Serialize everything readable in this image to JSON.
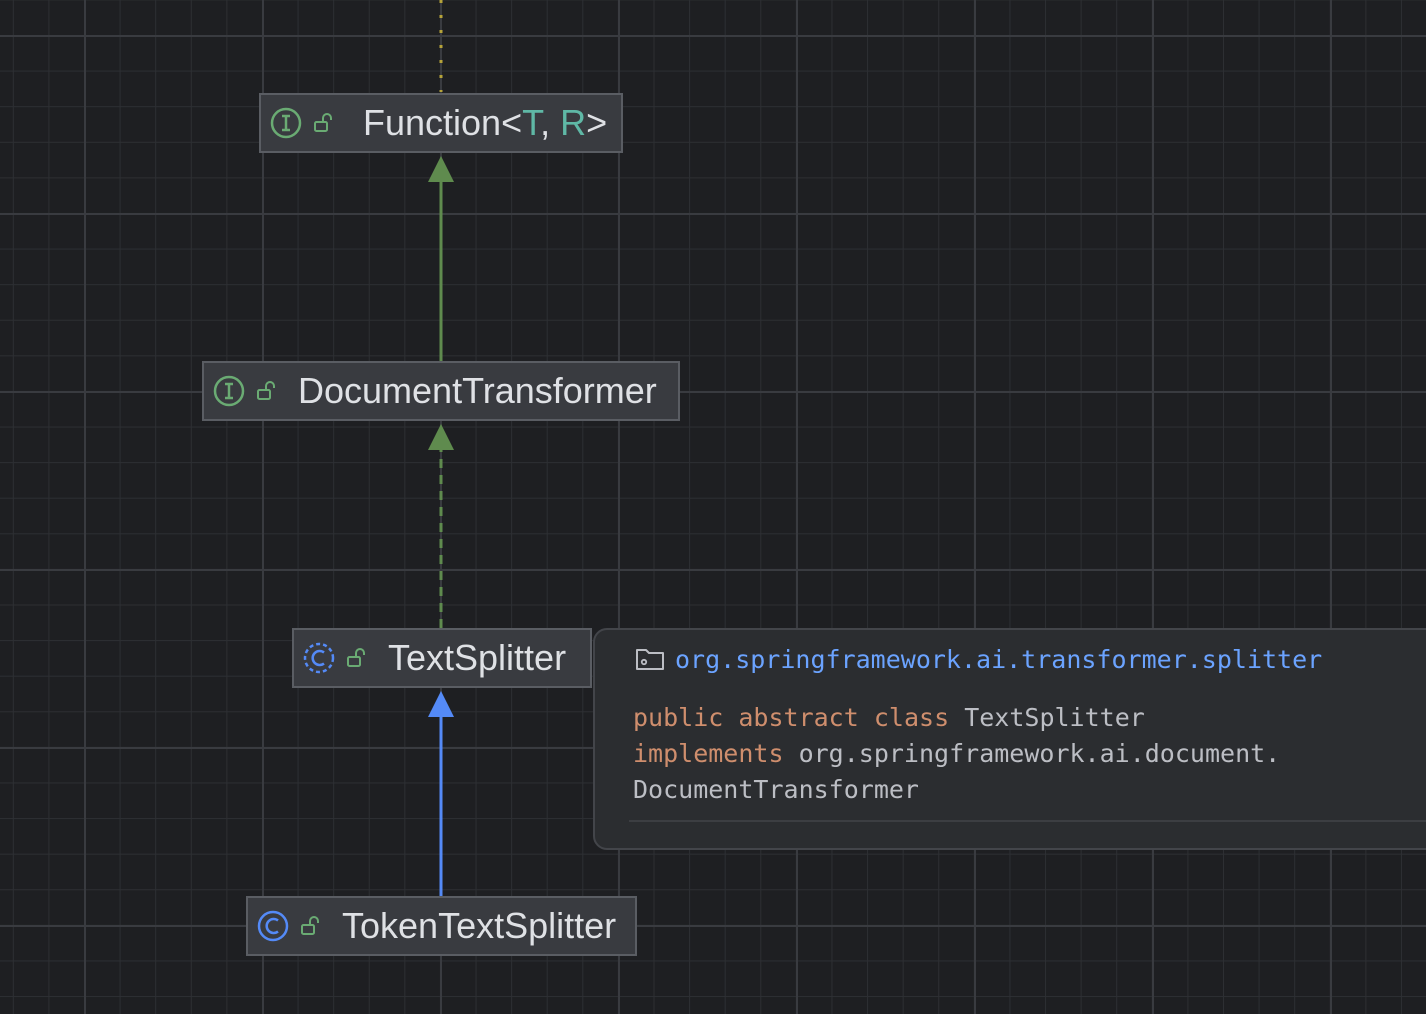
{
  "colors": {
    "background": "#1e1f22",
    "node_fill": "#393b40",
    "interface_icon": "#6aab73",
    "class_icon": "#548af7",
    "extends_edge": "#5f8b4e",
    "class_extends_edge": "#548af7",
    "type_param": "#5fb8a6",
    "keyword": "#cf8e6d",
    "package": "#6ba3ff"
  },
  "nodes": {
    "function": {
      "kind": "interface",
      "kind_icon": "interface-icon",
      "lock_icon": "open-lock-icon",
      "name": "Function",
      "open": "<",
      "param1": "T",
      "comma": ", ",
      "param2": "R",
      "close": ">"
    },
    "document_transformer": {
      "kind": "interface",
      "kind_icon": "interface-icon",
      "lock_icon": "open-lock-icon",
      "name": "DocumentTransformer"
    },
    "text_splitter": {
      "kind": "abstract-class",
      "kind_icon": "abstract-class-icon",
      "lock_icon": "open-lock-icon",
      "name": "TextSplitter"
    },
    "token_text_splitter": {
      "kind": "class",
      "kind_icon": "class-icon",
      "lock_icon": "open-lock-icon",
      "name": "TokenTextSplitter"
    }
  },
  "edges": [
    {
      "from": "document_transformer",
      "to": "function",
      "style": "solid",
      "color": "#5f8b4e"
    },
    {
      "from": "text_splitter",
      "to": "document_transformer",
      "style": "dashed",
      "color": "#5f8b4e"
    },
    {
      "from": "token_text_splitter",
      "to": "text_splitter",
      "style": "solid",
      "color": "#548af7"
    }
  ],
  "tooltip": {
    "package_icon": "package-folder-icon",
    "package": "org.springframework.ai.transformer.splitter",
    "kw_public": "public",
    "kw_abstract": "abstract",
    "kw_class": "class",
    "class_name": "TextSplitter",
    "kw_implements": "implements",
    "implements_path": "org.springframework.ai.document.",
    "implements_name": "DocumentTransformer"
  }
}
